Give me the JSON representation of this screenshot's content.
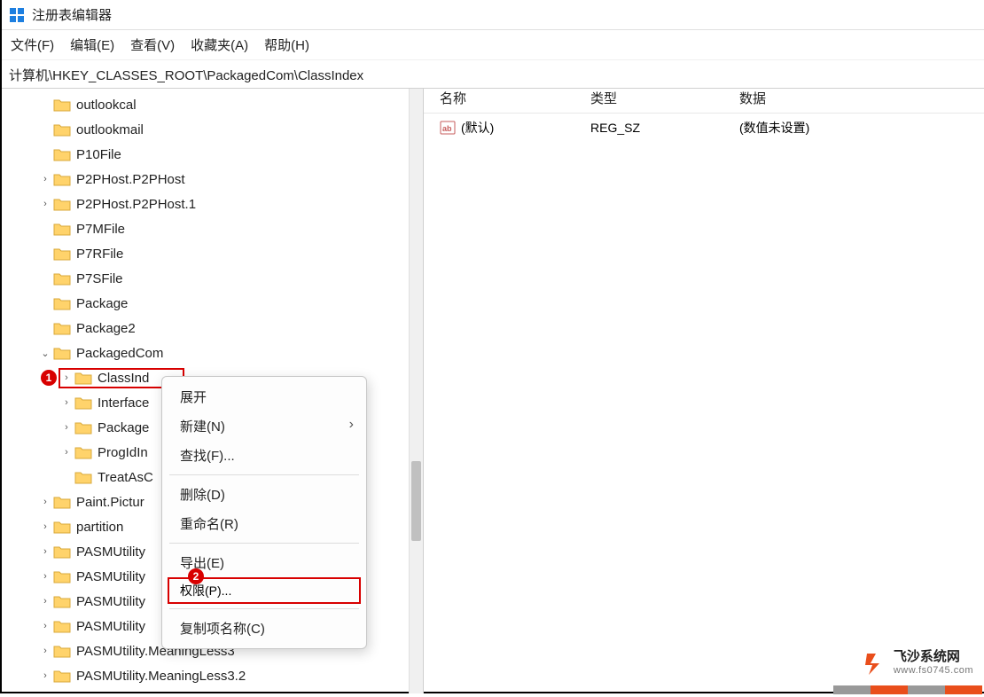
{
  "app": {
    "title": "注册表编辑器"
  },
  "menus": {
    "file": "文件(F)",
    "edit": "编辑(E)",
    "view": "查看(V)",
    "fav": "收藏夹(A)",
    "help": "帮助(H)"
  },
  "address": "计算机\\HKEY_CLASSES_ROOT\\PackagedCom\\ClassIndex",
  "tree": {
    "n0": "outlookcal",
    "n1": "outlookmail",
    "n2": "P10File",
    "n3": "P2PHost.P2PHost",
    "n4": "P2PHost.P2PHost.1",
    "n5": "P7MFile",
    "n6": "P7RFile",
    "n7": "P7SFile",
    "n8": "Package",
    "n9": "Package2",
    "n10": "PackagedCom",
    "n10a": "ClassInd",
    "n10b": "Interface",
    "n10c": "Package",
    "n10d": "ProgIdIn",
    "n10e": "TreatAsC",
    "n11": "Paint.Pictur",
    "n12": "partition",
    "n13": "PASMUtility",
    "n14": "PASMUtility",
    "n15": "PASMUtility",
    "n16": "PASMUtility",
    "n17": "PASMUtility.MeaningLess3",
    "n18": "PASMUtility.MeaningLess3.2"
  },
  "list": {
    "col_name": "名称",
    "col_type": "类型",
    "col_data": "数据",
    "row0_name": "(默认)",
    "row0_type": "REG_SZ",
    "row0_data": "(数值未设置)"
  },
  "ctx": {
    "expand": "展开",
    "new": "新建(N)",
    "find": "查找(F)...",
    "delete": "删除(D)",
    "rename": "重命名(R)",
    "export": "导出(E)",
    "perm": "权限(P)...",
    "copyname": "复制项名称(C)"
  },
  "badge": {
    "one": "1",
    "two": "2"
  },
  "watermark": {
    "text1": "飞沙系统网",
    "text2": "www.fs0745.com"
  }
}
